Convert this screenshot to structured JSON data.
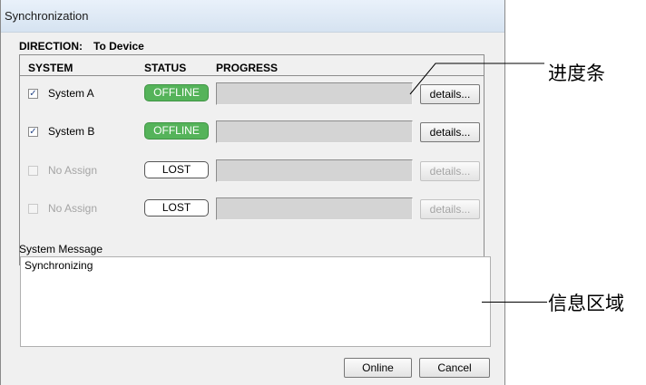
{
  "window": {
    "title": "Synchronization"
  },
  "direction": {
    "label": "DIRECTION:",
    "value": "To Device"
  },
  "columns": {
    "system": "SYSTEM",
    "status": "STATUS",
    "progress": "PROGRESS"
  },
  "rows": [
    {
      "checked": true,
      "system": "System A",
      "status": "OFFLINE",
      "status_kind": "offline",
      "progress": 0,
      "details": "details...",
      "enabled": true
    },
    {
      "checked": true,
      "system": "System B",
      "status": "OFFLINE",
      "status_kind": "offline",
      "progress": 0,
      "details": "details...",
      "enabled": true
    },
    {
      "checked": false,
      "system": "No Assign",
      "status": "LOST",
      "status_kind": "lost",
      "progress": 0,
      "details": "details...",
      "enabled": false
    },
    {
      "checked": false,
      "system": "No Assign",
      "status": "LOST",
      "status_kind": "lost",
      "progress": 0,
      "details": "details...",
      "enabled": false
    }
  ],
  "message": {
    "label": "System Message",
    "text": "Synchronizing"
  },
  "buttons": {
    "online": "Online",
    "cancel": "Cancel"
  },
  "callouts": {
    "progress_bar": "进度条",
    "info_area": "信息区域"
  },
  "colors": {
    "offline_green": "#55b35a",
    "title_bar": "#d6e3f1",
    "window_bg": "#f0f0f0"
  }
}
